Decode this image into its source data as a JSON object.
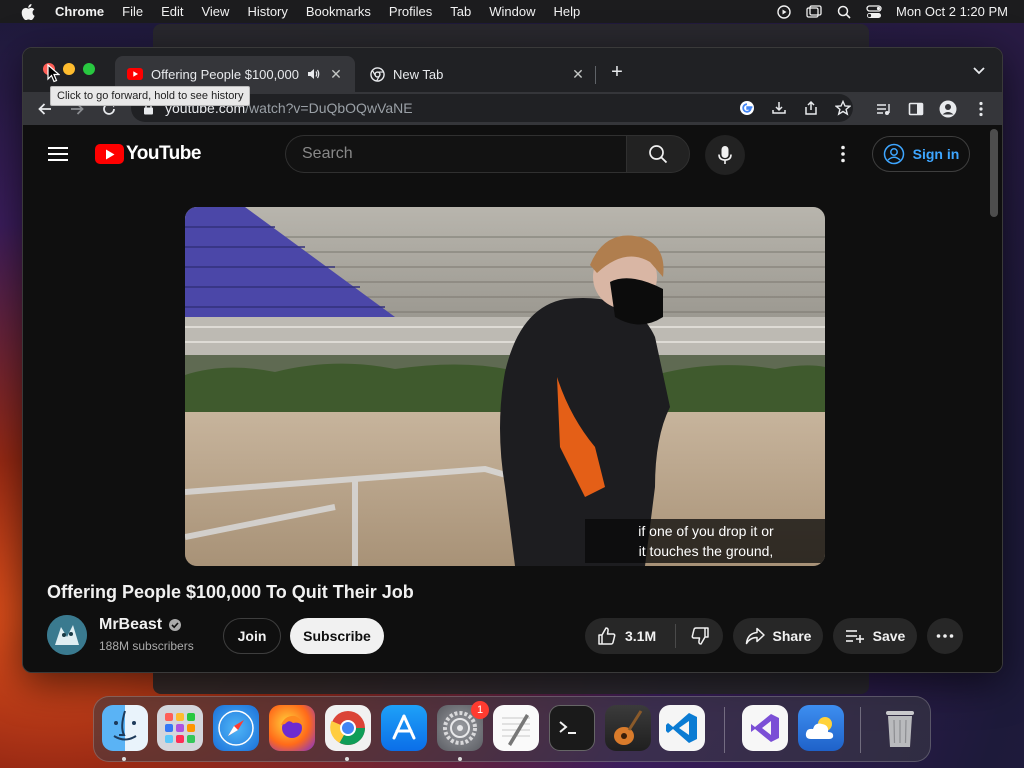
{
  "menubar": {
    "app_name": "Chrome",
    "menus": [
      "File",
      "Edit",
      "View",
      "History",
      "Bookmarks",
      "Profiles",
      "Tab",
      "Window",
      "Help"
    ],
    "clock": "Mon Oct 2  1:20 PM"
  },
  "browser": {
    "tabs": [
      {
        "title": "Offering People $100,000 To Quit Their Job",
        "favicon": "youtube-icon",
        "audio": true,
        "active": true
      },
      {
        "title": "New Tab",
        "favicon": "chrome-icon",
        "active": false
      }
    ],
    "address": {
      "domain": "youtube.com",
      "path": "/watch?v=DuQbOQwVaNE"
    },
    "tooltip": "Click to go forward, hold to see history"
  },
  "youtube": {
    "logo_text": "YouTube",
    "search_placeholder": "Search",
    "sign_in": "Sign in",
    "caption_line1": "if one of you drop it or",
    "caption_line2": "it touches the ground,",
    "video_title": "Offering People $100,000 To Quit Their Job",
    "channel_name": "MrBeast",
    "subscribers": "188M subscribers",
    "join_label": "Join",
    "subscribe_label": "Subscribe",
    "likes": "3.1M",
    "share_label": "Share",
    "save_label": "Save"
  },
  "dock": {
    "apps": [
      "Finder",
      "Launchpad",
      "Safari",
      "Firefox",
      "Chrome",
      "App Store",
      "System Settings",
      "TextEdit",
      "Terminal",
      "GarageBand",
      "Visual Studio Code",
      "Visual Studio",
      "Weather",
      "Trash"
    ],
    "settings_badge": "1"
  },
  "colors": {
    "youtube_red": "#ff0000",
    "link_blue": "#3ea6ff",
    "background": "#0f0f0f"
  }
}
